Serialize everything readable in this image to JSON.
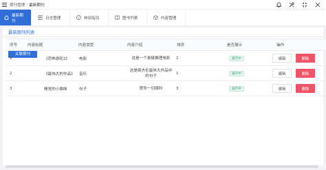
{
  "breadcrumb": {
    "parent": "期刊管理",
    "separator": "/",
    "current": "最新期刊"
  },
  "tabs": [
    {
      "label": "最新期刊",
      "icon": "home-icon",
      "active": true
    },
    {
      "label": "日志管理",
      "icon": "document-icon",
      "active": false
    },
    {
      "label": "林间有风",
      "icon": "info-circle-icon",
      "active": false
    },
    {
      "label": "图书列表",
      "icon": "book-icon",
      "active": false
    },
    {
      "label": "内容管理",
      "icon": "cube-icon",
      "active": false
    }
  ],
  "top_icons": [
    "bell-icon",
    "settings-icon",
    "fullscreen-exit-icon",
    "collapse-icon"
  ],
  "panel": {
    "title": "最新期刊列表",
    "link_button": "关联期刊"
  },
  "table": {
    "headers": [
      "序号",
      "内容标题",
      "内容类型",
      "内容介绍",
      "排序",
      "是否展示",
      "操作"
    ],
    "rows": [
      {
        "index": "1",
        "title": "《恐怖游轮2》",
        "type": "电影",
        "intro": "这是一个悬疑推理电影",
        "sort": "2",
        "status": "展示中",
        "edit": "编辑",
        "delete": "删除"
      },
      {
        "index": "2",
        "title": "《最伟大的作品》",
        "type": "音乐",
        "intro": "这是周杰伦最伟大作品中的句子",
        "sort": "1",
        "status": "展示中",
        "edit": "编辑",
        "delete": "删除"
      },
      {
        "index": "3",
        "title": "睡觉的小猫咪",
        "type": "句子",
        "intro": "愿你一切顺利",
        "sort": "3",
        "status": "展示中",
        "edit": "编辑",
        "delete": "删除"
      }
    ]
  },
  "colors": {
    "primary": "#2f6fd7",
    "danger": "#ee5366",
    "success": "#3aa57a"
  }
}
